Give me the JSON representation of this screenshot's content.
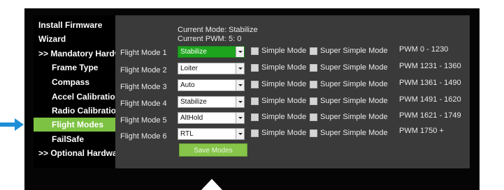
{
  "sidebar": {
    "items": [
      {
        "label": "Install Firmware",
        "level": "top"
      },
      {
        "label": "Wizard",
        "level": "top"
      },
      {
        "label": ">> Mandatory Hardware",
        "level": "top"
      },
      {
        "label": "Frame Type",
        "level": "sub"
      },
      {
        "label": "Compass",
        "level": "sub"
      },
      {
        "label": "Accel Calibration",
        "level": "sub"
      },
      {
        "label": "Radio Calibration",
        "level": "sub"
      },
      {
        "label": "Flight Modes",
        "level": "sub",
        "active": true
      },
      {
        "label": "FailSafe",
        "level": "sub"
      },
      {
        "label": ">> Optional Hardware",
        "level": "top"
      }
    ]
  },
  "status": {
    "current_mode_label": "Current Mode:",
    "current_mode_value": "Stabilize",
    "current_pwm_label": "Current PWM:",
    "current_pwm_value": "5: 0"
  },
  "modes": [
    {
      "label": "Flight Mode 1",
      "value": "Stabilize",
      "pwm": "PWM 0 - 1230",
      "active": true
    },
    {
      "label": "Flight Mode 2",
      "value": "Loiter",
      "pwm": "PWM 1231 - 1360"
    },
    {
      "label": "Flight Mode 3",
      "value": "Auto",
      "pwm": "PWM 1361 - 1490"
    },
    {
      "label": "Flight Mode 4",
      "value": "Stabilize",
      "pwm": "PWM 1491 - 1620"
    },
    {
      "label": "Flight Mode 5",
      "value": "AltHold",
      "pwm": "PWM 1621 - 1749"
    },
    {
      "label": "Flight Mode 6",
      "value": "RTL",
      "pwm": "PWM 1750 +"
    }
  ],
  "checkbox_labels": {
    "simple": "Simple Mode",
    "super_simple": "Super Simple Mode"
  },
  "save_button_label": "Save Modes",
  "colors": {
    "accent_green": "#7dc242",
    "active_select": "#1ea51e",
    "pointer_blue": "#1e8fd6"
  }
}
